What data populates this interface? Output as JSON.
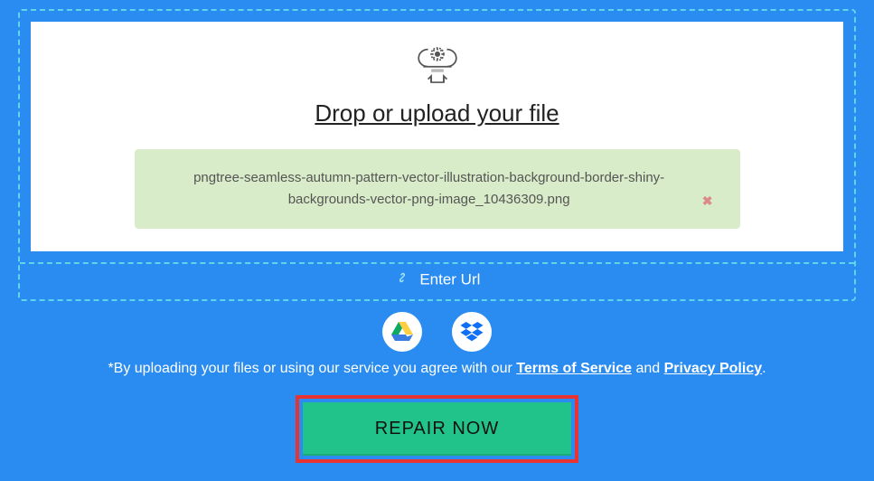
{
  "dropzone": {
    "title": "Drop or upload your file",
    "file": {
      "name": "pngtree-seamless-autumn-pattern-vector-illustration-background-border-shiny-backgrounds-vector-png-image_10436309.png",
      "remove_symbol": "✖"
    },
    "url_link": "Enter Url"
  },
  "legal": {
    "prefix": "*By uploading your files or using our service you agree with our ",
    "tos": "Terms of Service",
    "mid": " and ",
    "pp": "Privacy Policy",
    "suffix": "."
  },
  "cta": {
    "label": "REPAIR NOW"
  }
}
